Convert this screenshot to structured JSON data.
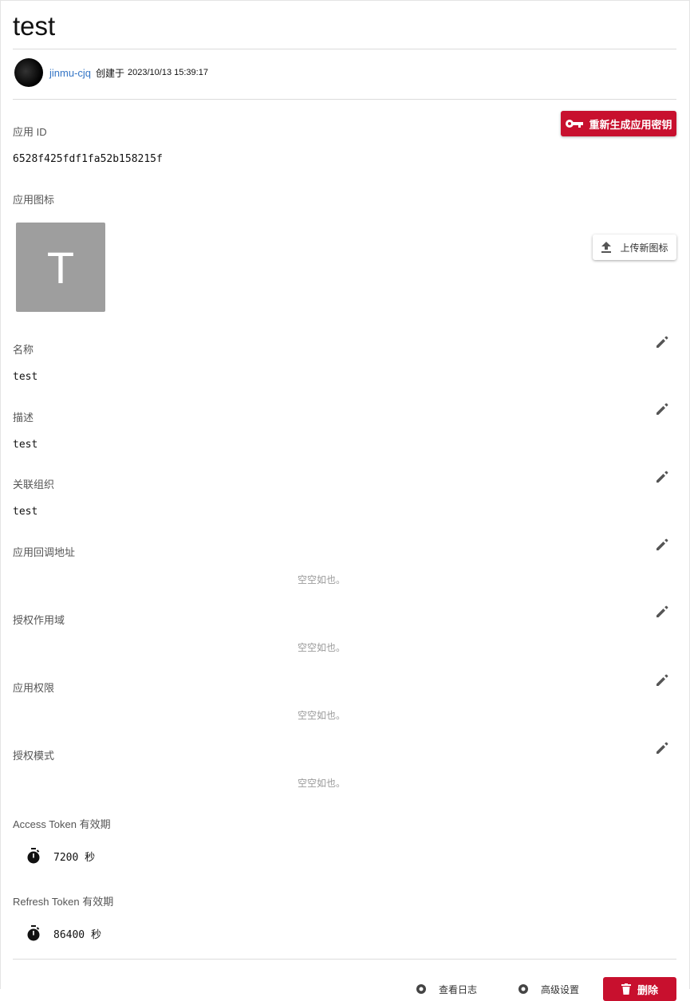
{
  "app": {
    "title": "test",
    "author": "jinmu-cjq",
    "created_prefix": "创建于",
    "created_at": "2023/10/13 15:39:17"
  },
  "buttons": {
    "regenerate_key": "重新生成应用密钥",
    "upload_icon": "上传新图标",
    "footer_btn_1": "查看日志",
    "footer_btn_2": "高级设置",
    "delete": "删除"
  },
  "fields": {
    "app_id": {
      "label": "应用 ID",
      "value": "6528f425fdf1fa52b158215f"
    },
    "app_icon": {
      "label": "应用图标",
      "letter": "T",
      "bg_color": "#9e9e9e"
    },
    "name": {
      "label": "名称",
      "value": "test"
    },
    "description": {
      "label": "描述",
      "value": "test"
    },
    "organization": {
      "label": "关联组织",
      "value": "test"
    },
    "callback_url": {
      "label": "应用回调地址",
      "empty": "空空如也。"
    },
    "scope": {
      "label": "授权作用域",
      "empty": "空空如也。"
    },
    "permissions": {
      "label": "应用权限",
      "empty": "空空如也。"
    },
    "grant_mode": {
      "label": "授权模式",
      "empty": "空空如也。"
    }
  },
  "tokens": {
    "access": {
      "label": "Access Token 有效期",
      "value": "7200 秒"
    },
    "refresh": {
      "label": "Refresh Token 有效期",
      "value": "86400 秒"
    }
  },
  "colors": {
    "primary": "#c8102e",
    "link": "#3576c6",
    "icon_bg": "#9e9e9e"
  },
  "icons": [
    "key-icon",
    "upload-icon",
    "edit-icon",
    "timer-icon",
    "delete-icon"
  ]
}
